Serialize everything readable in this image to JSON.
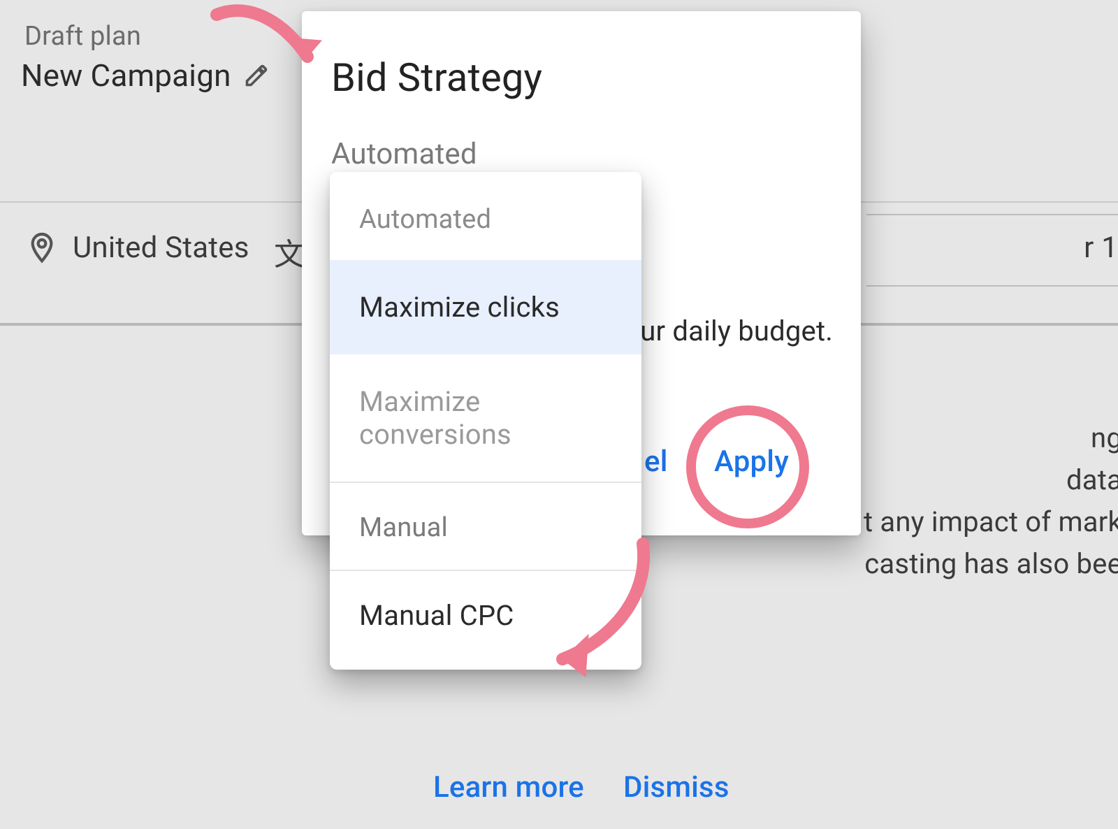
{
  "header": {
    "draft_label": "Draft plan",
    "campaign_name": "New Campaign"
  },
  "background": {
    "location": "United States",
    "right_r1": "r 1",
    "budget_fragment": "ur daily budget.",
    "frag_line1": "ng",
    "frag_line2": "data",
    "frag_line3": "t any impact of mark",
    "frag_line4": "casting has also bee",
    "learn_more": "Learn more",
    "dismiss": "Dismiss"
  },
  "panel": {
    "title": "Bid Strategy",
    "subtitle": "Automated",
    "cancel_fragment": "el",
    "apply": "Apply"
  },
  "dropdown": {
    "group1_label": "Automated",
    "opt_max_clicks": "Maximize clicks",
    "opt_max_conv": "Maximize conversions",
    "group2_label": "Manual",
    "opt_manual_cpc": "Manual CPC"
  }
}
